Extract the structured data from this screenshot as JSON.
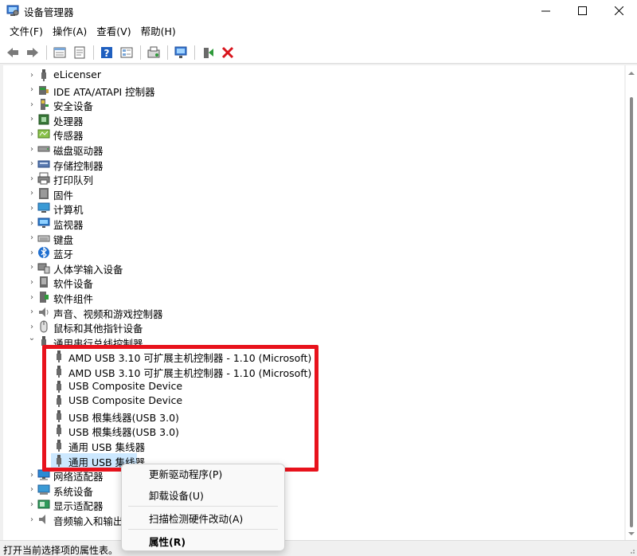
{
  "window": {
    "title": "设备管理器",
    "controls": {
      "minimize": "minimize",
      "maximize": "maximize",
      "close": "close"
    }
  },
  "menu": [
    {
      "label": "文件(F)"
    },
    {
      "label": "操作(A)"
    },
    {
      "label": "查看(V)"
    },
    {
      "label": "帮助(H)"
    }
  ],
  "toolbar": {
    "buttons": [
      "back-arrow-icon",
      "forward-arrow-icon",
      "device-list-icon",
      "properties-icon",
      "help-icon",
      "view-icon",
      "update-driver-icon",
      "monitor-scan-icon",
      "enable-device-icon",
      "remove-device-icon"
    ],
    "colors": {
      "remove": "#d8141c",
      "help": "#1f5fbf"
    }
  },
  "tree": {
    "categories": [
      {
        "label": "eLicenser",
        "icon": "usb-plug-icon"
      },
      {
        "label": "IDE ATA/ATAPI 控制器",
        "icon": "ide-controller-icon"
      },
      {
        "label": "安全设备",
        "icon": "security-device-icon"
      },
      {
        "label": "处理器",
        "icon": "processor-icon"
      },
      {
        "label": "传感器",
        "icon": "sensor-icon"
      },
      {
        "label": "磁盘驱动器",
        "icon": "disk-drive-icon"
      },
      {
        "label": "存储控制器",
        "icon": "storage-controller-icon"
      },
      {
        "label": "打印队列",
        "icon": "printer-icon"
      },
      {
        "label": "固件",
        "icon": "firmware-icon"
      },
      {
        "label": "计算机",
        "icon": "computer-icon"
      },
      {
        "label": "监视器",
        "icon": "monitor-icon"
      },
      {
        "label": "键盘",
        "icon": "keyboard-icon"
      },
      {
        "label": "蓝牙",
        "icon": "bluetooth-icon"
      },
      {
        "label": "人体学输入设备",
        "icon": "hid-icon"
      },
      {
        "label": "软件设备",
        "icon": "software-device-icon"
      },
      {
        "label": "软件组件",
        "icon": "software-component-icon"
      },
      {
        "label": "声音、视频和游戏控制器",
        "icon": "speaker-icon"
      },
      {
        "label": "鼠标和其他指针设备",
        "icon": "mouse-icon"
      }
    ],
    "usb_category": {
      "label": "通用串行总线控制器",
      "expanded": true,
      "children": [
        {
          "label": "AMD USB 3.10 可扩展主机控制器 - 1.10 (Microsoft)"
        },
        {
          "label": "AMD USB 3.10 可扩展主机控制器 - 1.10 (Microsoft)"
        },
        {
          "label": "USB Composite Device"
        },
        {
          "label": "USB Composite Device"
        },
        {
          "label": "USB 根集线器(USB 3.0)"
        },
        {
          "label": "USB 根集线器(USB 3.0)"
        },
        {
          "label": "通用 USB 集线器"
        },
        {
          "label": "通用 USB 集线器",
          "selected": true
        }
      ]
    },
    "after_categories": [
      {
        "label": "网络适配器",
        "icon": "network-adapter-icon"
      },
      {
        "label": "系统设备",
        "icon": "system-device-icon"
      },
      {
        "label": "显示适配器",
        "icon": "display-adapter-icon"
      },
      {
        "label": "音频输入和输出",
        "icon": "audio-io-icon"
      }
    ]
  },
  "context_menu": {
    "items": [
      {
        "label": "更新驱动程序(P)"
      },
      {
        "label": "卸载设备(U)"
      },
      {
        "label": "扫描检测硬件改动(A)"
      },
      {
        "label": "属性(R)",
        "bold": true
      }
    ]
  },
  "status": {
    "text": "打开当前选择项的属性表。"
  },
  "annotation": {
    "color": "#e8121c"
  },
  "colors": {
    "selection": "#cce8ff",
    "accent": "#0078d4"
  }
}
